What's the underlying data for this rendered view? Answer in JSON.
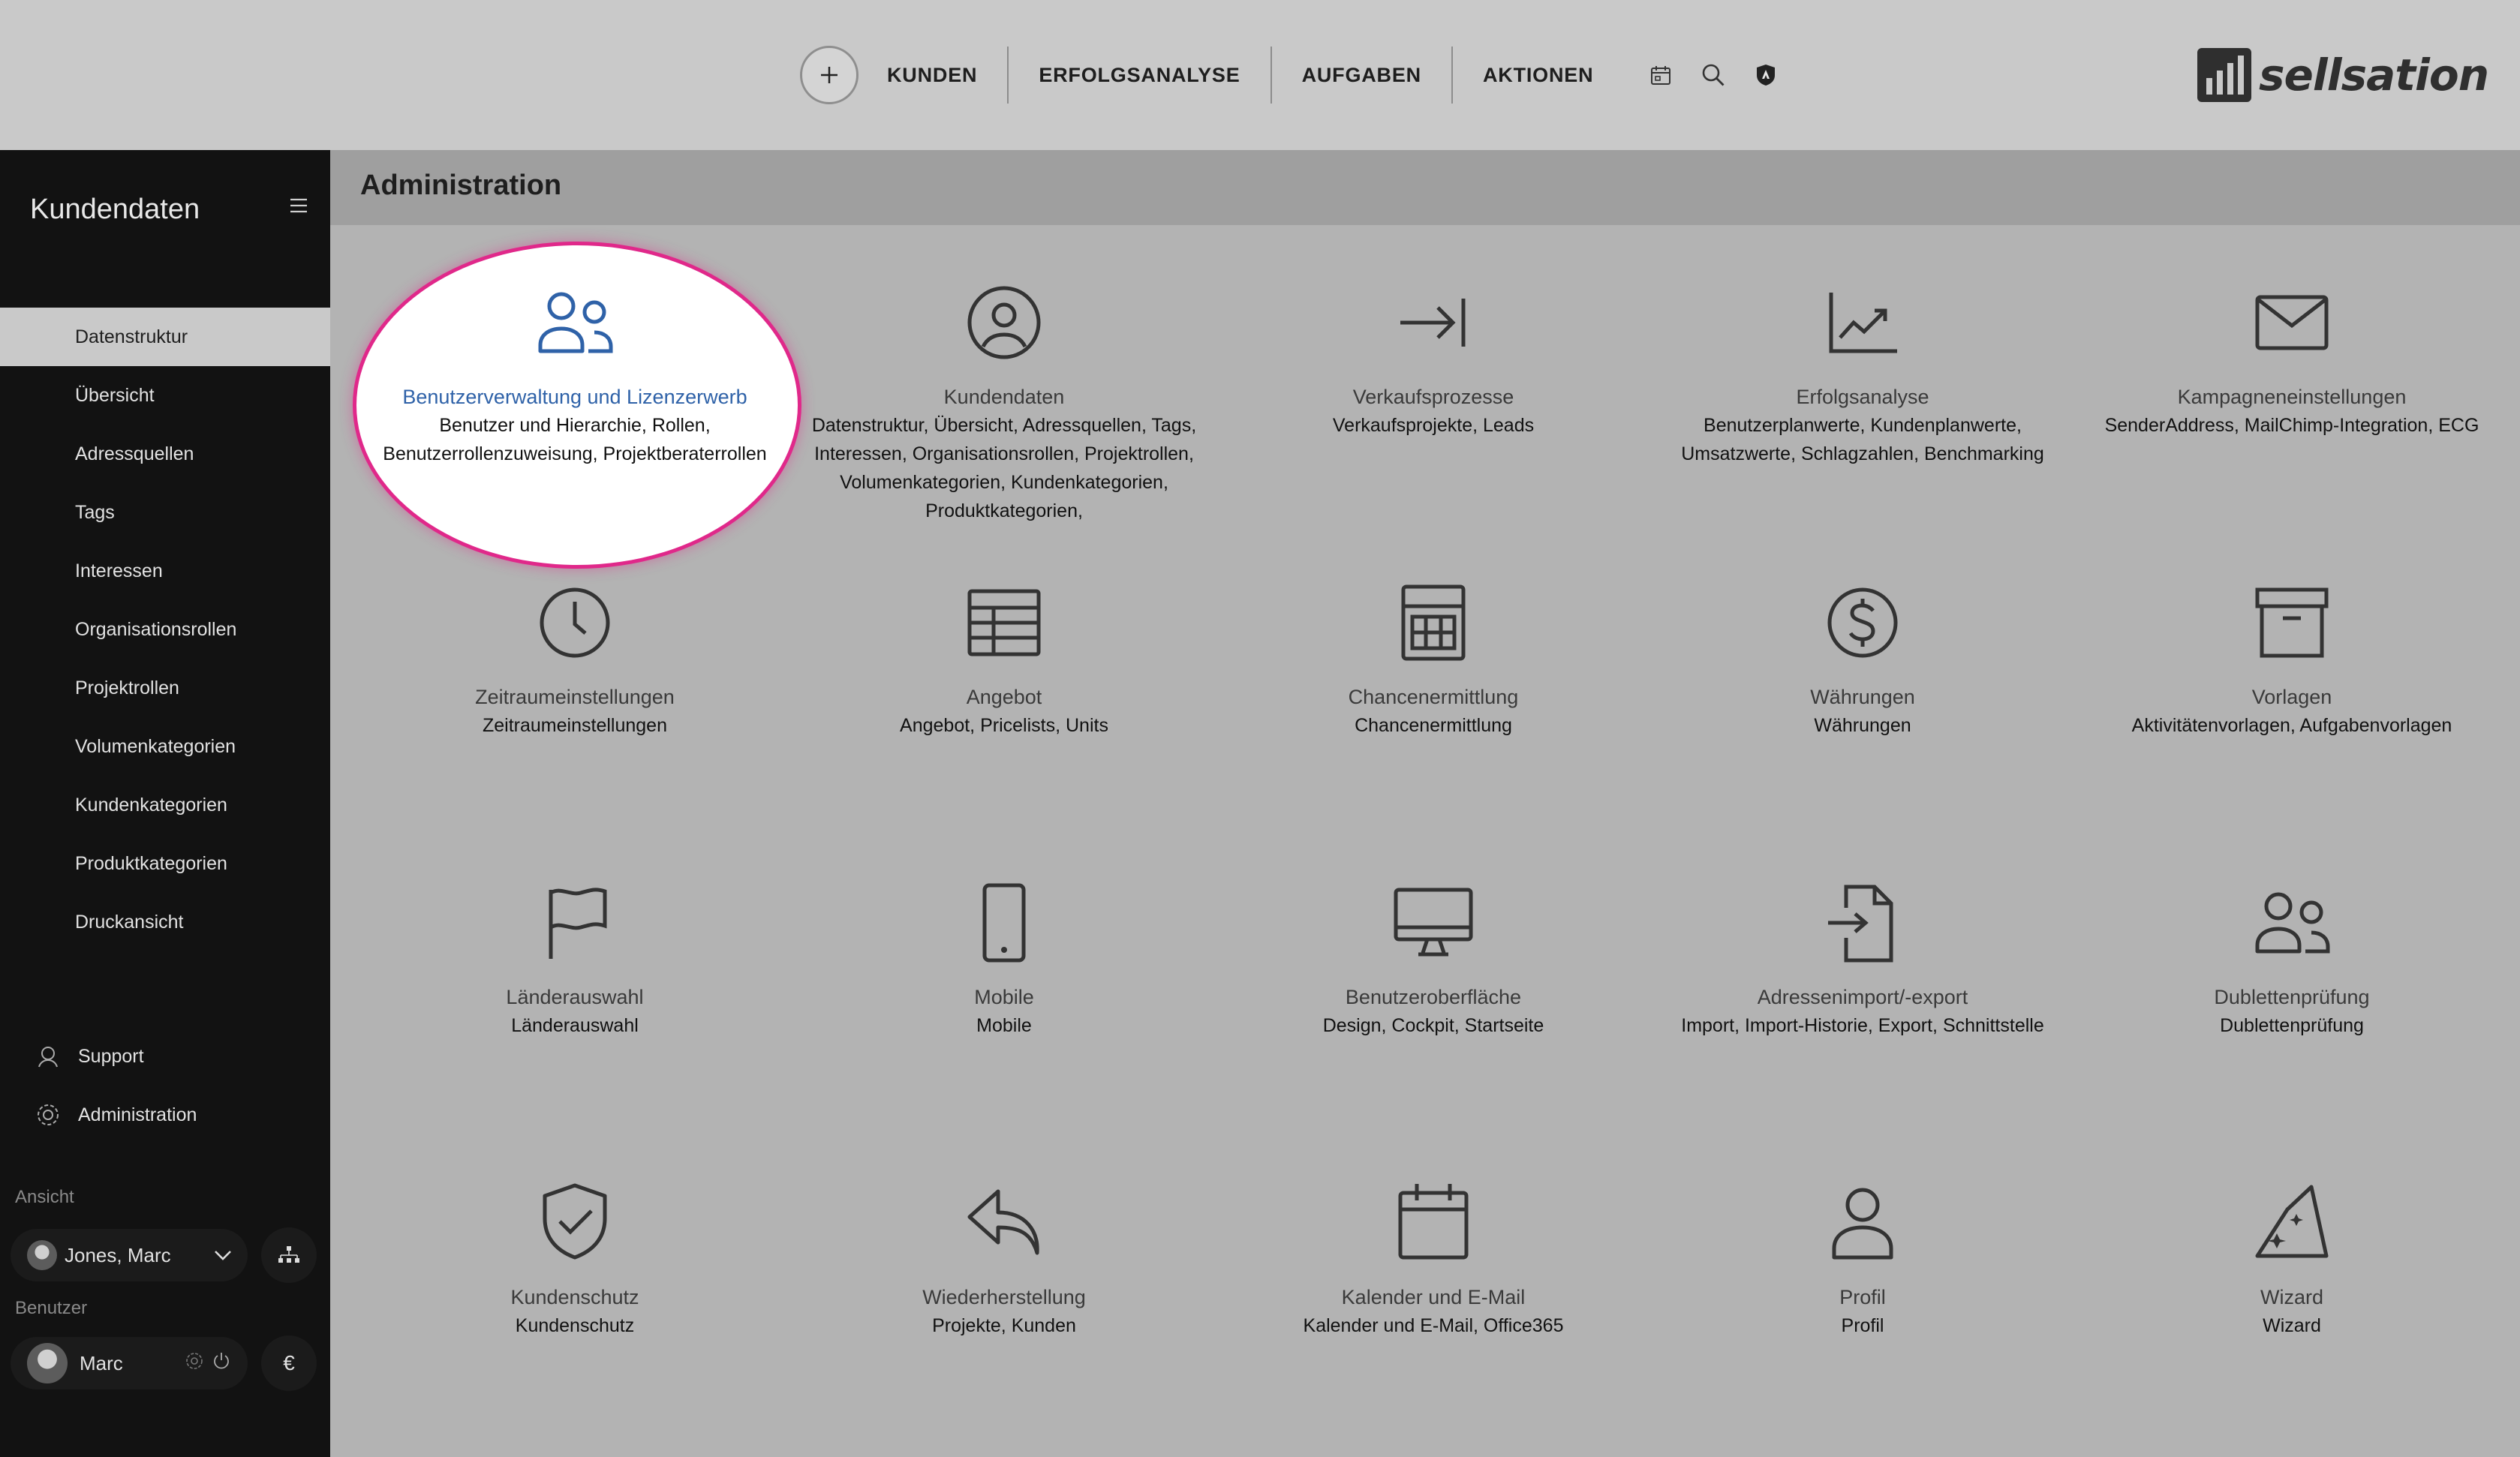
{
  "topnav": {
    "plus_label": "+",
    "items": [
      "KUNDEN",
      "ERFOLGSANALYSE",
      "AUFGABEN",
      "AKTIONEN"
    ],
    "icons": [
      "calendar-icon",
      "search-icon",
      "shield-icon"
    ]
  },
  "brand": {
    "logo_text": "sellsation"
  },
  "sidebar": {
    "title": "Kundendaten",
    "items": [
      {
        "label": "Datenstruktur",
        "active": true
      },
      {
        "label": "Übersicht"
      },
      {
        "label": "Adressquellen"
      },
      {
        "label": "Tags"
      },
      {
        "label": "Interessen"
      },
      {
        "label": "Organisationsrollen"
      },
      {
        "label": "Projektrollen"
      },
      {
        "label": "Volumenkategorien"
      },
      {
        "label": "Kundenkategorien"
      },
      {
        "label": "Produktkategorien"
      },
      {
        "label": "Druckansicht"
      }
    ],
    "support_label": "Support",
    "admin_label": "Administration",
    "view_section": "Ansicht",
    "view_user": "Jones, Marc",
    "user_section": "Benutzer",
    "user_name": "Marc",
    "currency_symbol": "€"
  },
  "main": {
    "title": "Administration",
    "tiles": [
      {
        "icon": "users-icon",
        "name": "Benutzerverwaltung und Lizenzerwerb",
        "desc": "Benutzer und Hierarchie, Rollen, Benutzerrollenzuweisung, Projektberaterrollen",
        "highlighted": true
      },
      {
        "icon": "user-circle-icon",
        "name": "Kundendaten",
        "desc": "Datenstruktur, Übersicht, Adressquellen, Tags, Interessen, Organisationsrollen, Projektrollen, Volumenkategorien, Kundenkategorien, Produktkategorien,"
      },
      {
        "icon": "arrow-to-line-icon",
        "name": "Verkaufsprozesse",
        "desc": "Verkaufsprojekte, Leads"
      },
      {
        "icon": "chart-trend-icon",
        "name": "Erfolgsanalyse",
        "desc": "Benutzerplanwerte, Kundenplanwerte, Umsatzwerte, Schlagzahlen, Benchmarking"
      },
      {
        "icon": "envelope-icon",
        "name": "Kampagneneinstellungen",
        "desc": "SenderAddress, MailChimp-Integration, ECG"
      },
      {
        "icon": "clock-icon",
        "name": "Zeitraumeinstellungen",
        "desc": "Zeitraumeinstellungen"
      },
      {
        "icon": "table-icon",
        "name": "Angebot",
        "desc": "Angebot, Pricelists, Units"
      },
      {
        "icon": "calculator-icon",
        "name": "Chancenermittlung",
        "desc": "Chancenermittlung"
      },
      {
        "icon": "dollar-icon",
        "name": "Währungen",
        "desc": "Währungen"
      },
      {
        "icon": "archive-icon",
        "name": "Vorlagen",
        "desc": "Aktivitätenvorlagen, Aufgabenvorlagen"
      },
      {
        "icon": "flag-icon",
        "name": "Länderauswahl",
        "desc": "Länderauswahl"
      },
      {
        "icon": "mobile-icon",
        "name": "Mobile",
        "desc": "Mobile"
      },
      {
        "icon": "desktop-icon",
        "name": "Benutzeroberfläche",
        "desc": "Design, Cockpit, Startseite"
      },
      {
        "icon": "file-import-icon",
        "name": "Adressenimport/-export",
        "desc": "Import, Import-Historie, Export, Schnittstelle"
      },
      {
        "icon": "users-duplicate-icon",
        "name": "Dublettenprüfung",
        "desc": "Dublettenprüfung"
      },
      {
        "icon": "shield-check-icon",
        "name": "Kundenschutz",
        "desc": "Kundenschutz"
      },
      {
        "icon": "undo-arrow-icon",
        "name": "Wiederherstellung",
        "desc": "Projekte, Kunden"
      },
      {
        "icon": "calendar-icon",
        "name": "Kalender und E-Mail",
        "desc": "Kalender und E-Mail, Office365"
      },
      {
        "icon": "user-icon",
        "name": "Profil",
        "desc": "Profil"
      },
      {
        "icon": "wizard-hat-icon",
        "name": "Wizard",
        "desc": "Wizard"
      }
    ]
  },
  "colors": {
    "topbar": "#c9c9c9",
    "sidebar": "#121212",
    "content": "#b3b3b3",
    "highlight_border": "#e0288a",
    "highlight_title": "#2f62a8"
  }
}
